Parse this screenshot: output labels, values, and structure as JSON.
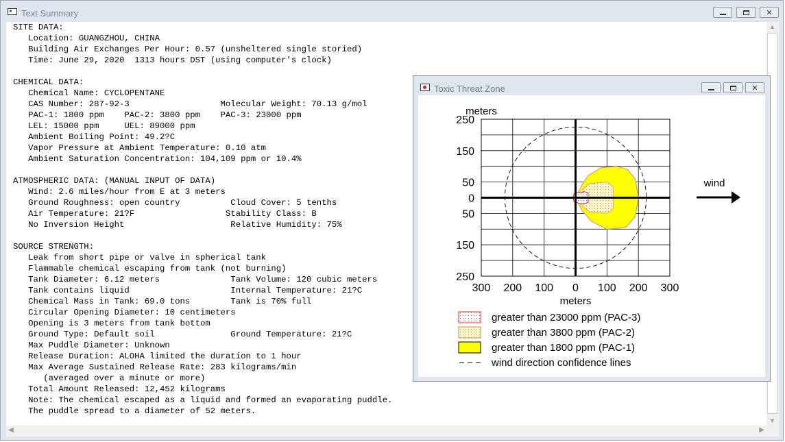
{
  "window": {
    "title": "Text Summary",
    "report_lines": [
      "SITE DATA:",
      "   Location: GUANGZHOU, CHINA",
      "   Building Air Exchanges Per Hour: 0.57 (unsheltered single storied)",
      "   Time: June 29, 2020  1313 hours DST (using computer's clock)",
      "",
      "CHEMICAL DATA:",
      "   Chemical Name: CYCLOPENTANE",
      "   CAS Number: 287-92-3                  Molecular Weight: 70.13 g/mol",
      "   PAC-1: 1800 ppm    PAC-2: 3800 ppm    PAC-3: 23000 ppm",
      "   LEL: 15000 ppm     UEL: 89000 ppm",
      "   Ambient Boiling Point: 49.2?C",
      "   Vapor Pressure at Ambient Temperature: 0.10 atm",
      "   Ambient Saturation Concentration: 104,109 ppm or 10.4%",
      "",
      "ATMOSPHERIC DATA: (MANUAL INPUT OF DATA)",
      "   Wind: 2.6 miles/hour from E at 3 meters",
      "   Ground Roughness: open country          Cloud Cover: 5 tenths",
      "   Air Temperature: 21?F                  Stability Class: B",
      "   No Inversion Height                     Relative Humidity: 75%",
      "",
      "SOURCE STRENGTH:",
      "   Leak from short pipe or valve in spherical tank",
      "   Flammable chemical escaping from tank (not burning)",
      "   Tank Diameter: 6.12 meters              Tank Volume: 120 cubic meters",
      "   Tank contains liquid                    Internal Temperature: 21?C",
      "   Chemical Mass in Tank: 69.0 tons        Tank is 70% full",
      "   Circular Opening Diameter: 10 centimeters",
      "   Opening is 3 meters from tank bottom",
      "   Ground Type: Default soil               Ground Temperature: 21?C",
      "   Max Puddle Diameter: Unknown",
      "   Release Duration: ALOHA limited the duration to 1 hour",
      "   Max Average Sustained Release Rate: 283 kilograms/min",
      "      (averaged over a minute or more)",
      "   Total Amount Released: 12,452 kilograms",
      "   Note: The chemical escaped as a liquid and formed an evaporating puddle.",
      "   The puddle spread to a diameter of 52 meters."
    ]
  },
  "threat_window": {
    "title": "Toxic Threat Zone",
    "wind_label": "wind"
  },
  "chart_data": {
    "type": "map",
    "ylabel": "meters",
    "xlabel": "meters",
    "x_ticks": [
      "300",
      "200",
      "100",
      "0",
      "100",
      "200",
      "300"
    ],
    "y_ticks": [
      "250",
      "150",
      "50",
      "0",
      "50",
      "150",
      "250"
    ],
    "xlim": [
      -300,
      300
    ],
    "ylim": [
      -250,
      250
    ],
    "grid": true,
    "zones": [
      {
        "name": "greater than 23000 ppm (PAC-3)",
        "color": "#e34040",
        "fill": "dotted-red",
        "max_downwind_m": 55
      },
      {
        "name": "greater than 3800 ppm (PAC-2)",
        "color": "#e8d28a",
        "fill": "dotted-tan",
        "max_downwind_m": 150
      },
      {
        "name": "greater than 1800 ppm (PAC-1)",
        "color": "#ffff00",
        "fill": "solid-yellow",
        "max_downwind_m": 225
      }
    ],
    "confidence_lines_label": "wind direction confidence lines",
    "confidence_radius_m": 225,
    "wind_direction": "east-to-west (arrow points right)"
  }
}
